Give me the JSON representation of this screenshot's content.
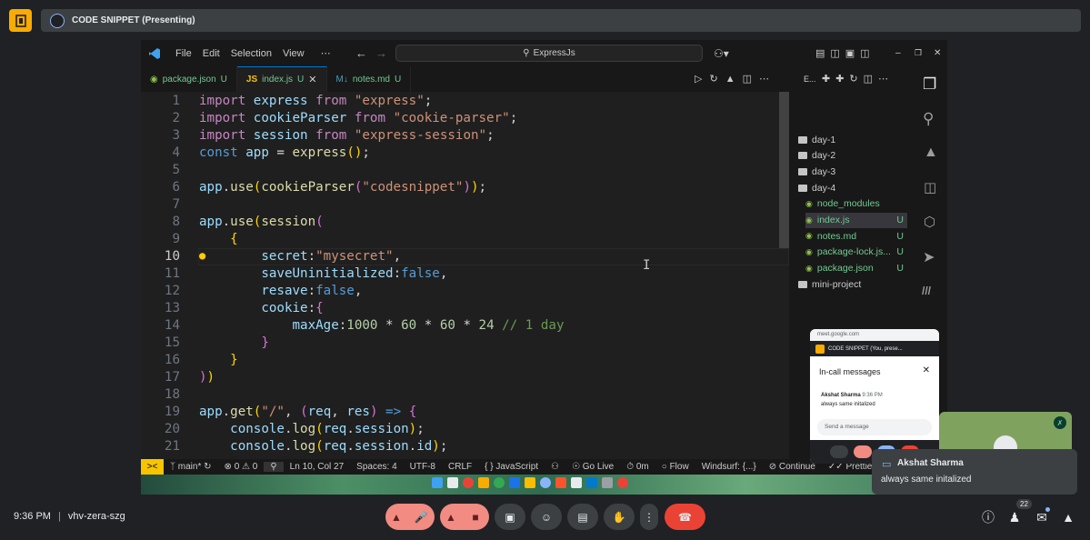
{
  "meet": {
    "title": "CODE SNIPPET (Presenting)",
    "time": "9:36 PM",
    "meeting_code": "vhv-zera-szg",
    "participants_count": "22"
  },
  "vscode": {
    "menu": [
      "File",
      "Edit",
      "Selection",
      "View",
      "⋯"
    ],
    "search_text": "ExpressJs",
    "tabs": [
      {
        "label": "package.json",
        "badge": "U"
      },
      {
        "label": "index.js",
        "badge": "U"
      },
      {
        "label": "notes.md",
        "badge": "U"
      }
    ],
    "explorer_header": "E...",
    "tree": [
      {
        "label": "day-1",
        "kind": "folder"
      },
      {
        "label": "day-2",
        "kind": "folder"
      },
      {
        "label": "day-3",
        "kind": "folder"
      },
      {
        "label": "day-4",
        "kind": "folder"
      },
      {
        "label": "node_modules",
        "kind": "child"
      },
      {
        "label": "index.js",
        "kind": "child",
        "badge": "U"
      },
      {
        "label": "notes.md",
        "kind": "child",
        "badge": "U"
      },
      {
        "label": "package-lock.js...",
        "kind": "child",
        "badge": "U"
      },
      {
        "label": "package.json",
        "kind": "child",
        "badge": "U"
      },
      {
        "label": "mini-project",
        "kind": "folder"
      }
    ],
    "line_numbers": [
      "1",
      "2",
      "3",
      "4",
      "5",
      "6",
      "7",
      "8",
      "9",
      "10",
      "11",
      "12",
      "13",
      "14",
      "15",
      "16",
      "17",
      "18",
      "19",
      "20",
      "21"
    ],
    "status": {
      "branch": "main*",
      "problems": "⊗ 0 ⚠ 0",
      "position": "Ln 10, Col 27",
      "spaces": "Spaces: 4",
      "encoding": "UTF-8",
      "eol": "CRLF",
      "language": "{ }  JavaScript",
      "golive": "Go Live",
      "timer": "0m",
      "flow": "Flow",
      "windsurf": "Windsurf: {...}",
      "continue": "Continue",
      "prettier": "Prettier"
    }
  },
  "chat": {
    "url": "meet.google.com",
    "mini_title": "CODE SNIPPET (You, prese...",
    "header": "In-call messages",
    "sender": "Akshat Sharma",
    "time": "9:36 PM",
    "message": "always same initalized",
    "input_placeholder": "Send a message"
  },
  "notification": {
    "sender": "Akshat Sharma",
    "message": "always same initalized"
  },
  "colors": {
    "meet_bg": "#202124",
    "end_call": "#ea4335",
    "muted": "#f28b82",
    "accent": "#f9ab00"
  }
}
